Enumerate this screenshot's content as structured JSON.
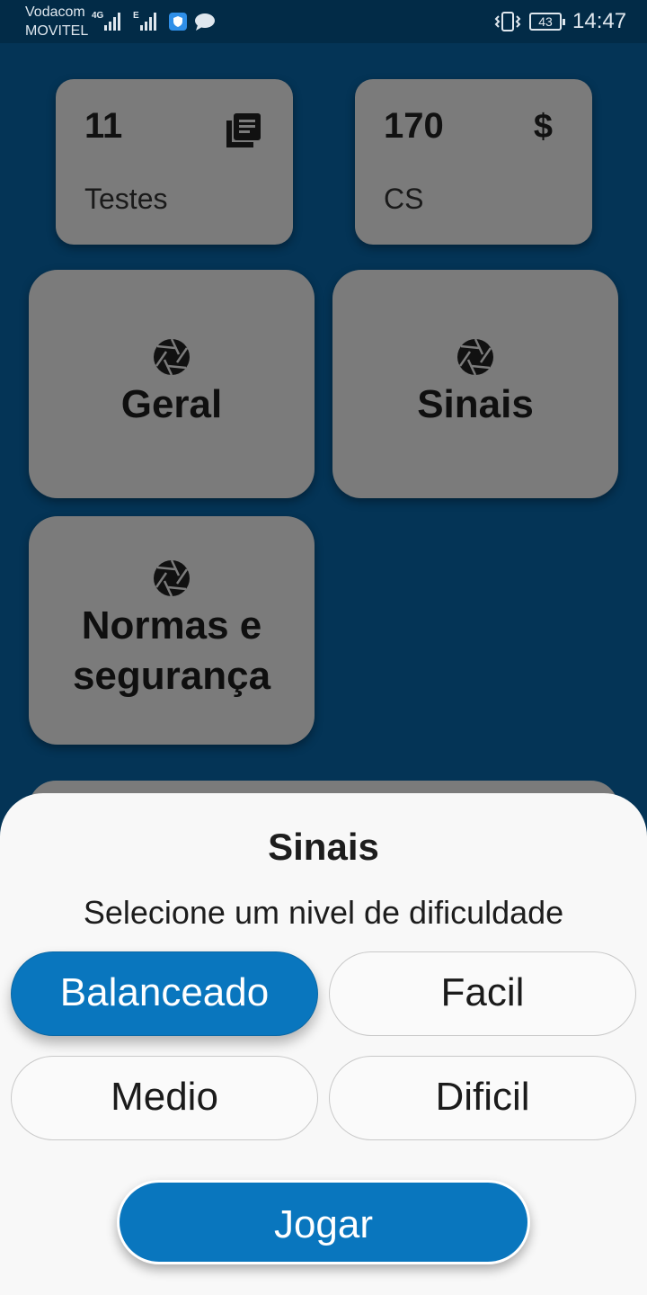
{
  "status_bar": {
    "carrier_primary": "Vodacom",
    "carrier_secondary": "MOVITEL",
    "network_1": "4G",
    "network_2": "E",
    "battery": "43",
    "time": "14:47"
  },
  "stats": [
    {
      "value": "11",
      "label": "Testes",
      "icon": "book-stack-icon"
    },
    {
      "value": "170",
      "label": "CS",
      "icon": "dollar-icon",
      "symbol": "$"
    }
  ],
  "categories": [
    {
      "title": "Geral",
      "icon": "camera-aperture-icon"
    },
    {
      "title": "Sinais",
      "icon": "camera-aperture-icon"
    },
    {
      "title_line1": "Normas e",
      "title_line2": "segurança",
      "icon": "camera-aperture-icon"
    }
  ],
  "sheet": {
    "title": "Sinais",
    "subtitle": "Selecione um nivel de dificuldade",
    "options": [
      "Balanceado",
      "Facil",
      "Medio",
      "Dificil"
    ],
    "selected": "Balanceado",
    "play_label": "Jogar"
  },
  "colors": {
    "background": "#043456",
    "card": "#7b7b7b",
    "accent": "#0976be",
    "sheet": "#f8f8f8"
  }
}
